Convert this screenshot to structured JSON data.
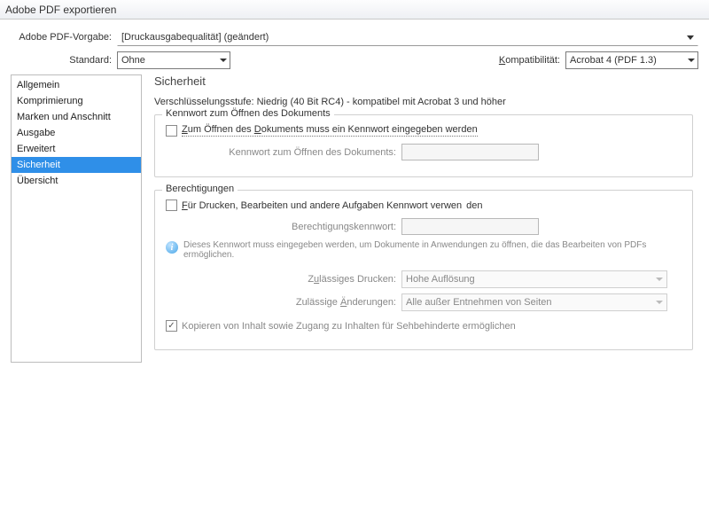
{
  "window": {
    "title": "Adobe PDF exportieren"
  },
  "top": {
    "preset_label": "Adobe PDF-Vorgabe:",
    "preset_value": "[Druckausgabequalität] (geändert)",
    "standard_label": "Standard:",
    "standard_value": "Ohne",
    "compat_label": "Kompatibilität:",
    "compat_value": "Acrobat 4 (PDF 1.3)"
  },
  "sidebar": {
    "items": [
      "Allgemein",
      "Komprimierung",
      "Marken und Anschnitt",
      "Ausgabe",
      "Erweitert",
      "Sicherheit",
      "Übersicht"
    ],
    "selected_index": 5
  },
  "main": {
    "title": "Sicherheit",
    "encryption_line": "Verschlüsselungsstufe: Niedrig (40 Bit RC4) - kompatibel mit Acrobat 3 und höher",
    "group_open": {
      "legend": "Kennwort zum Öffnen des Dokuments",
      "chk_label": "Zum Öffnen des Dokuments muss ein Kennwort eingegeben werden",
      "pw_label": "Kennwort zum Öffnen des Dokuments:"
    },
    "group_perm": {
      "legend": "Berechtigungen",
      "chk_label": "Für Drucken, Bearbeiten und andere Aufgaben Kennwort verwenden",
      "pw_label": "Berechtigungskennwort:",
      "info_text": "Dieses Kennwort muss eingegeben werden, um Dokumente in Anwendungen zu öffnen, die das Bearbeiten von PDFs ermöglichen.",
      "print_label": "Zulässiges Drucken:",
      "print_value": "Hohe Auflösung",
      "changes_label": "Zulässige Änderungen:",
      "changes_value": "Alle außer Entnehmen von Seiten",
      "copy_label": "Kopieren von Inhalt sowie Zugang zu Inhalten für Sehbehinderte ermöglichen"
    }
  }
}
